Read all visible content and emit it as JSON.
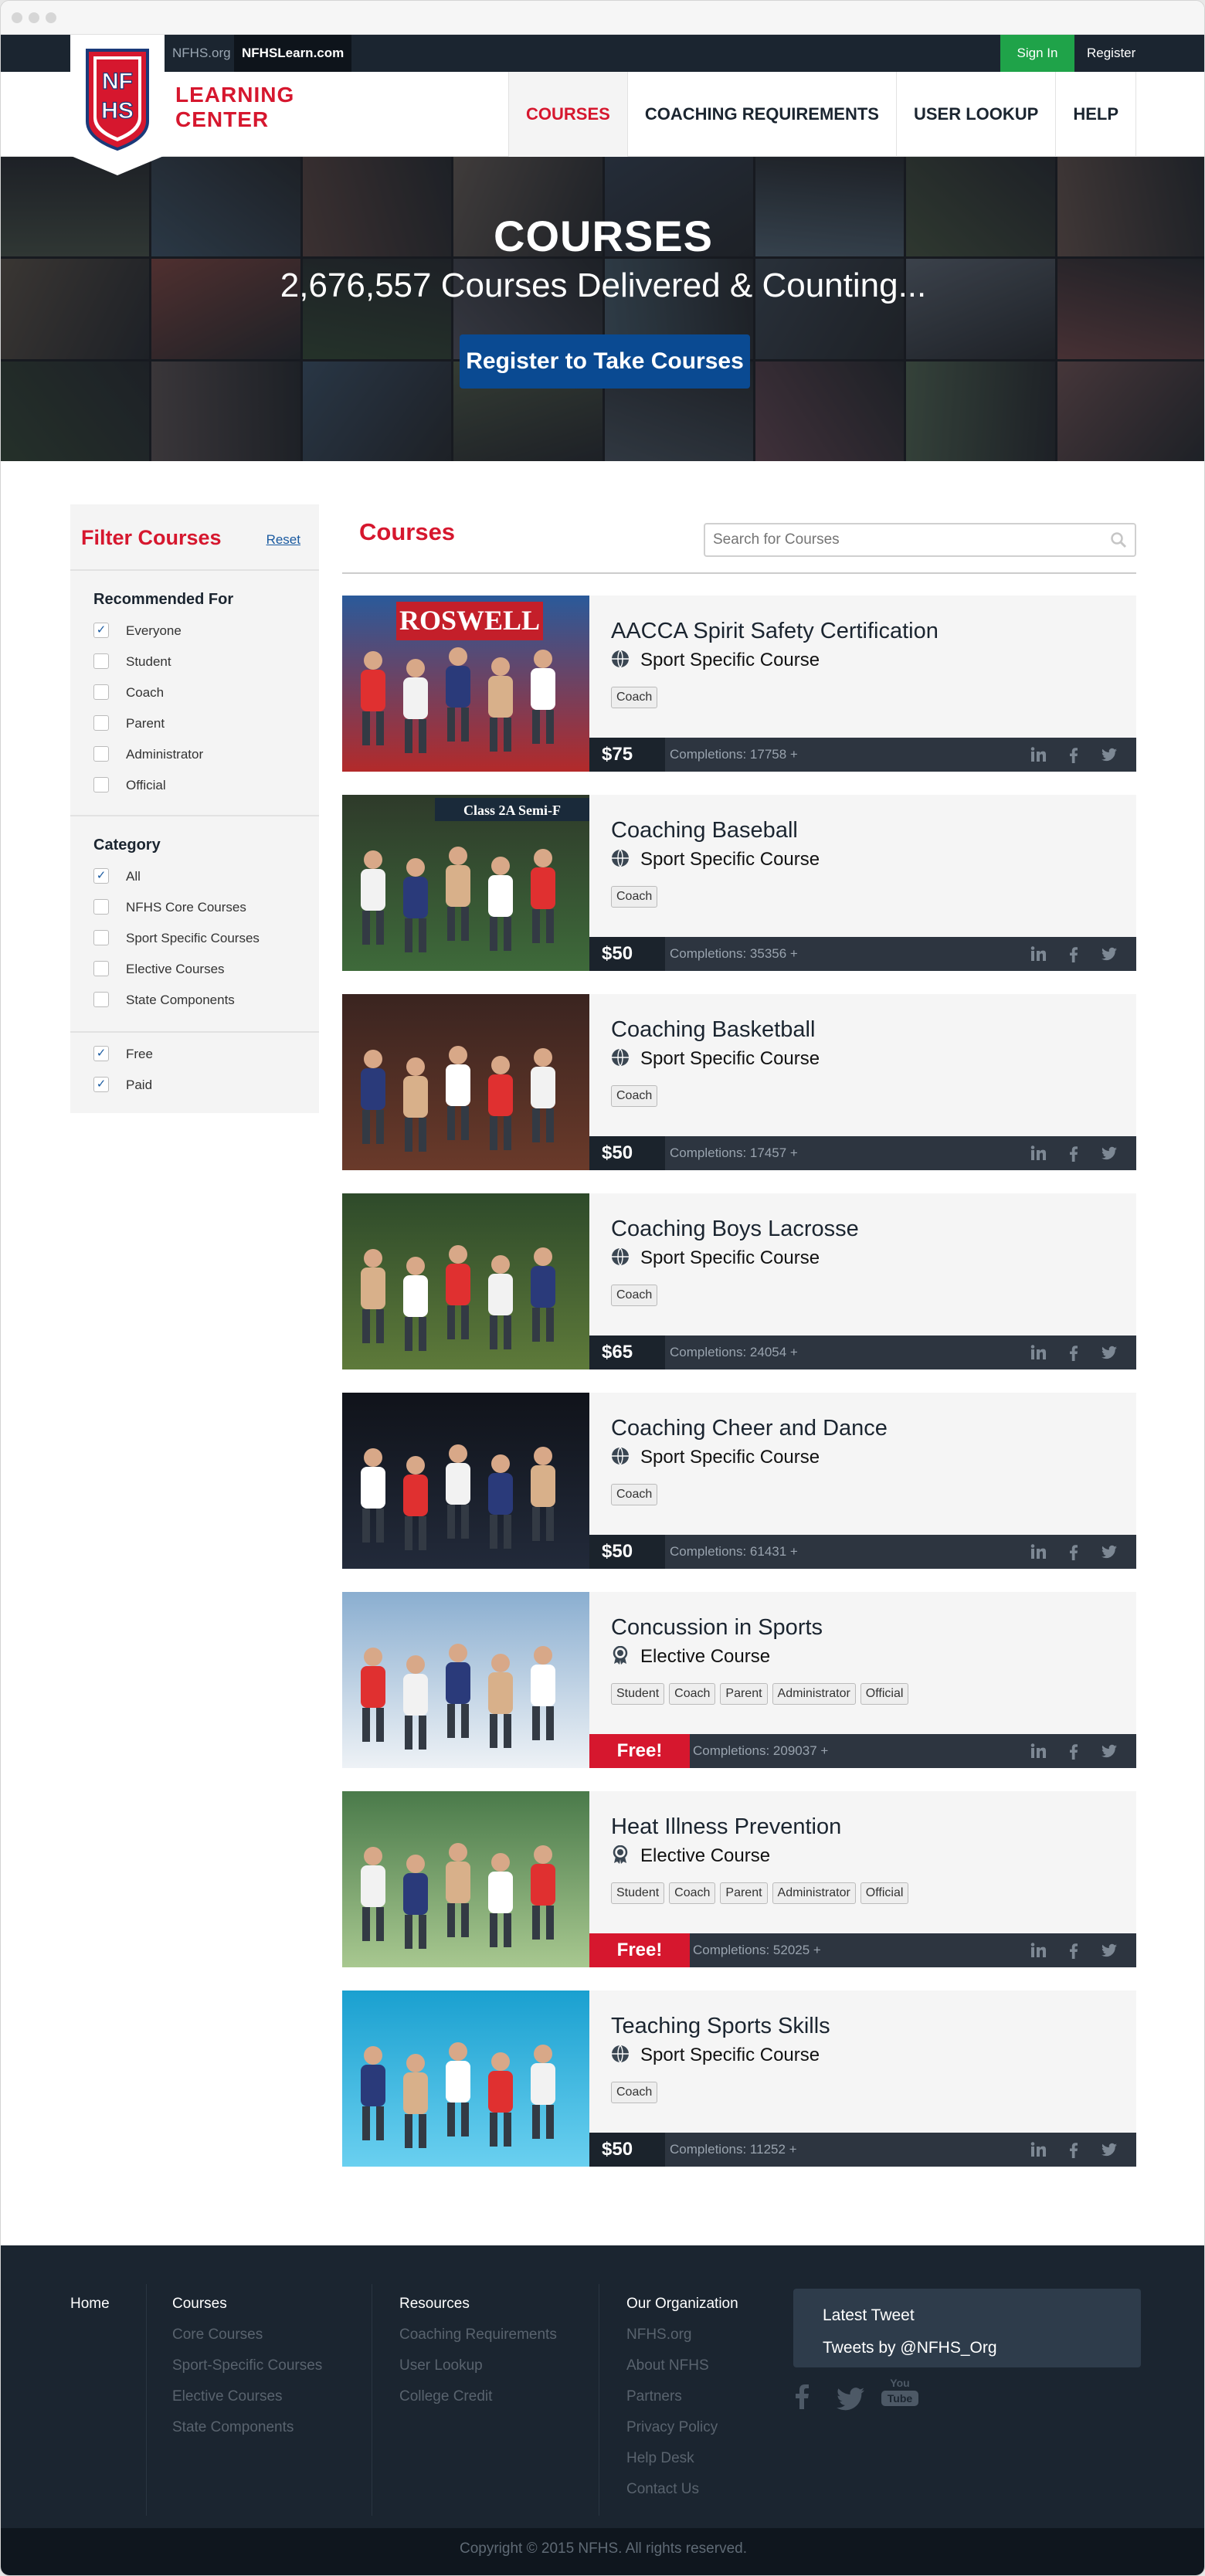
{
  "topbar": {
    "org_link": "NFHS.org",
    "learn_link": "NFHSLearn.com",
    "sign_in": "Sign In",
    "register": "Register"
  },
  "logo": {
    "text": "NFHS"
  },
  "brand": {
    "line1": "LEARNING",
    "line2": "CENTER"
  },
  "nav": [
    {
      "label": "COURSES",
      "active": true
    },
    {
      "label": "COACHING REQUIREMENTS"
    },
    {
      "label": "USER LOOKUP"
    },
    {
      "label": "HELP"
    }
  ],
  "hero": {
    "title": "COURSES",
    "subtitle": "2,676,557 Courses Delivered & Counting...",
    "button": "Register to Take Courses"
  },
  "sidebar": {
    "title": "Filter Courses",
    "reset": "Reset",
    "recommended_title": "Recommended For",
    "recommended": [
      {
        "label": "Everyone",
        "checked": true
      },
      {
        "label": "Student",
        "checked": false
      },
      {
        "label": "Coach",
        "checked": false
      },
      {
        "label": "Parent",
        "checked": false
      },
      {
        "label": "Administrator",
        "checked": false
      },
      {
        "label": "Official",
        "checked": false
      }
    ],
    "category_title": "Category",
    "category": [
      {
        "label": "All",
        "checked": true
      },
      {
        "label": "NFHS Core Courses",
        "checked": false
      },
      {
        "label": "Sport Specific Courses",
        "checked": false
      },
      {
        "label": "Elective Courses",
        "checked": false
      },
      {
        "label": "State Components",
        "checked": false
      }
    ],
    "pricing": [
      {
        "label": "Free",
        "checked": true
      },
      {
        "label": "Paid",
        "checked": true
      }
    ]
  },
  "main": {
    "title": "Courses",
    "search_placeholder": "Search for Courses"
  },
  "courses": [
    {
      "title": "AACCA Spirit Safety Certification",
      "type": "Sport Specific Course",
      "icon": "ball-icon",
      "tags": [
        "Coach"
      ],
      "price": "$75",
      "free": false,
      "completions": "Completions: 17758 +",
      "photo": "Cheerleaders in front of a ROSWELL banner",
      "banner": "ROSWELL"
    },
    {
      "title": "Coaching Baseball",
      "type": "Sport Specific Course",
      "icon": "ball-icon",
      "tags": [
        "Coach"
      ],
      "price": "$50",
      "free": false,
      "completions": "Completions: 35356 +",
      "photo": "Baseball play at home plate",
      "banner": "Class 2A Semi-F"
    },
    {
      "title": "Coaching Basketball",
      "type": "Sport Specific Course",
      "icon": "ball-icon",
      "tags": [
        "Coach"
      ],
      "price": "$50",
      "free": false,
      "completions": "Completions: 17457 +",
      "photo": "Girls basketball game",
      "banner": ""
    },
    {
      "title": "Coaching Boys Lacrosse",
      "type": "Sport Specific Course",
      "icon": "ball-icon",
      "tags": [
        "Coach"
      ],
      "price": "$65",
      "free": false,
      "completions": "Completions: 24054 +",
      "photo": "Boys lacrosse players",
      "banner": ""
    },
    {
      "title": "Coaching Cheer and Dance",
      "type": "Sport Specific Course",
      "icon": "ball-icon",
      "tags": [
        "Coach"
      ],
      "price": "$50",
      "free": false,
      "completions": "Completions: 61431 +",
      "photo": "Cheer squad on dark background",
      "banner": ""
    },
    {
      "title": "Concussion in Sports",
      "type": "Elective Course",
      "icon": "ribbon-icon",
      "tags": [
        "Student",
        "Coach",
        "Parent",
        "Administrator",
        "Official"
      ],
      "price": "Free!",
      "free": true,
      "completions": "Completions: 209037 +",
      "photo": "Medic checking athlete eyes",
      "banner": ""
    },
    {
      "title": "Heat Illness Prevention",
      "type": "Elective Course",
      "icon": "ribbon-icon",
      "tags": [
        "Student",
        "Coach",
        "Parent",
        "Administrator",
        "Official"
      ],
      "price": "Free!",
      "free": true,
      "completions": "Completions: 52025 +",
      "photo": "Tennis players drinking water",
      "banner": ""
    },
    {
      "title": "Teaching Sports Skills",
      "type": "Sport Specific Course",
      "icon": "ball-icon",
      "tags": [
        "Coach"
      ],
      "price": "$50",
      "free": false,
      "completions": "Completions: 11252 +",
      "photo": "Coach at swimming pool",
      "banner": ""
    }
  ],
  "footer": {
    "home": "Home",
    "courses_title": "Courses",
    "courses_links": [
      "Core Courses",
      "Sport-Specific Courses",
      "Elective Courses",
      "State Components"
    ],
    "resources_title": "Resources",
    "resources_links": [
      "Coaching Requirements",
      "User Lookup",
      "College Credit"
    ],
    "org_title": "Our Organization",
    "org_links": [
      "NFHS.org",
      "About NFHS",
      "Partners",
      "Privacy Policy",
      "Help Desk",
      "Contact Us"
    ],
    "tweet_title": "Latest Tweet",
    "tweet_by": "Tweets by @NFHS_Org",
    "youtube_you": "You",
    "youtube_tube": "Tube",
    "copyright": "Copyright © 2015 NFHS. All rights reserved."
  },
  "colors": {
    "brand_red": "#d6172e",
    "navy": "#1b2530",
    "blue": "#0a4a92",
    "green": "#1fa349"
  }
}
